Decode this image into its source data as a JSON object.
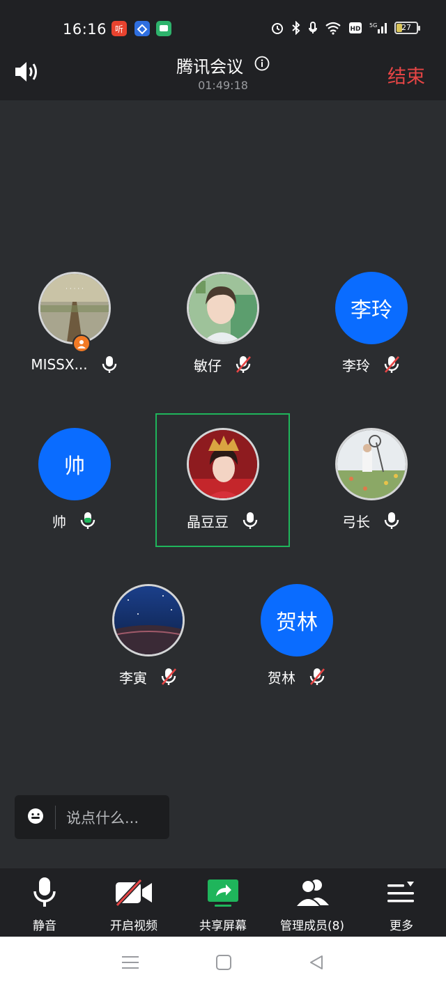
{
  "status_bar": {
    "time": "16:16",
    "app_icons": [
      "ting-app-icon",
      "bank-app-icon",
      "chat-app-icon"
    ],
    "battery": "27"
  },
  "header": {
    "title": "腾讯会议",
    "duration": "01:49:18",
    "end_label": "结束"
  },
  "participants": [
    {
      "name": "MISSX...",
      "avatar_type": "photo",
      "muted": false,
      "host": true
    },
    {
      "name": "敏仔",
      "avatar_type": "photo",
      "muted": true
    },
    {
      "name": "李玲",
      "avatar_type": "text",
      "avatar_text": "李玲",
      "muted": true
    },
    {
      "name": "帅",
      "avatar_type": "text",
      "avatar_text": "帅",
      "muted": false,
      "speaking": true
    },
    {
      "name": "晶豆豆",
      "avatar_type": "photo",
      "muted": false,
      "active": true
    },
    {
      "name": "弓长",
      "avatar_type": "photo",
      "muted": false
    },
    {
      "name": "李寅",
      "avatar_type": "photo",
      "muted": true
    },
    {
      "name": "贺林",
      "avatar_type": "text",
      "avatar_text": "贺林",
      "muted": true
    }
  ],
  "chat": {
    "placeholder": "说点什么..."
  },
  "toolbar": {
    "mute_label": "静音",
    "video_label": "开启视频",
    "share_label": "共享屏幕",
    "members_label": "管理成员(8)",
    "more_label": "更多"
  },
  "colors": {
    "accent_blue": "#0a6cff",
    "end_red": "#e64545",
    "share_green": "#1fb55b",
    "background": "#2b2d30"
  }
}
